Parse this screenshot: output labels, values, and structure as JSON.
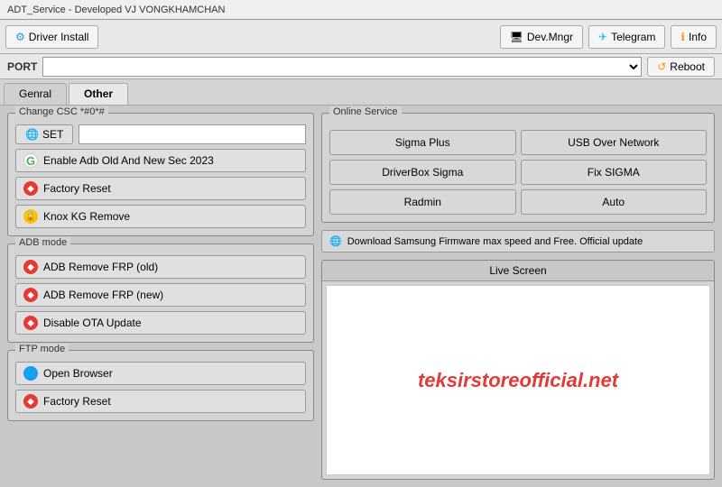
{
  "titleBar": {
    "text": "ADT_Service - Developed VJ VONGKHAMCHAN"
  },
  "toolbar": {
    "driverInstall": "Driver Install",
    "devMngr": "Dev.Mngr",
    "telegram": "Telegram",
    "info": "Info"
  },
  "portBar": {
    "label": "PORT",
    "reboot": "Reboot"
  },
  "tabs": [
    {
      "label": "Genral",
      "active": false
    },
    {
      "label": "Other",
      "active": true
    }
  ],
  "leftPanel": {
    "cscSection": {
      "title": "Change CSC  *#0*#",
      "setBtn": "SET",
      "inputPlaceholder": "",
      "enableAdb": "Enable Adb Old And New Sec 2023",
      "factoryReset": "Factory Reset",
      "knoxRemove": "Knox KG Remove"
    },
    "adbSection": {
      "title": "ADB mode",
      "removeFrpOld": "ADB Remove FRP (old)",
      "removeFrpNew": "ADB Remove FRP (new)",
      "disableOTA": "Disable OTA Update"
    },
    "ftpSection": {
      "title": "FTP mode",
      "openBrowser": "Open Browser",
      "factoryReset": "Factory Reset"
    }
  },
  "rightPanel": {
    "onlineSection": {
      "title": "Online Service",
      "buttons": [
        "Sigma Plus",
        "USB Over Network",
        "DriverBox Sigma",
        "Fix SIGMA",
        "Radmin",
        "Auto"
      ]
    },
    "downloadBar": "Download Samsung Firmware max speed and Free. Official update",
    "liveScreen": {
      "title": "Live Screen",
      "watermark": "teksirstoreofficial.net"
    }
  }
}
